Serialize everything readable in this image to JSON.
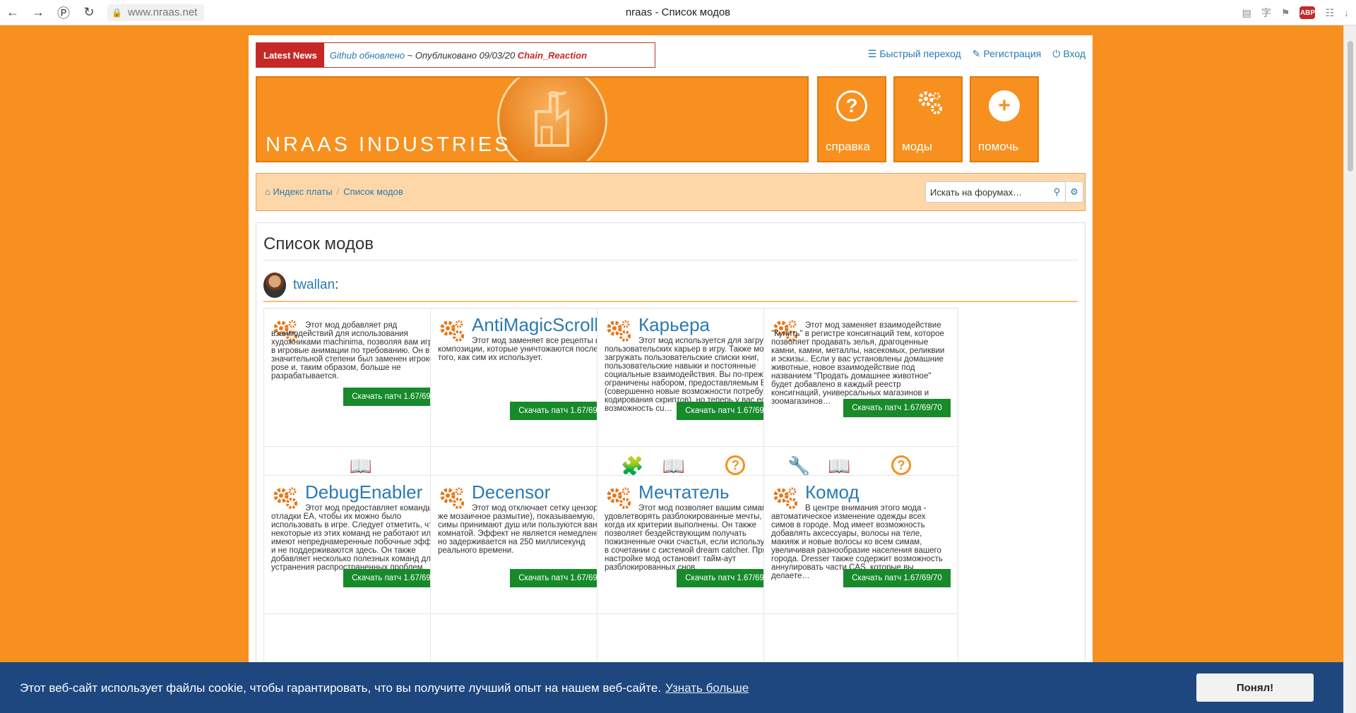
{
  "browser": {
    "url": "www.nraas.net",
    "tab_title": "nraas - Список модов"
  },
  "news": {
    "tag": "Latest News",
    "link": "Github обновлено",
    "middle": " ~ Опубликовано 09/03/20 ",
    "author": "Chain_Reaction"
  },
  "top_links": {
    "jump": "Быстрый переход",
    "register": "Регистрация",
    "login": "Вход"
  },
  "banner": {
    "title": "NRAAS INDUSTRIES"
  },
  "tiles": {
    "help": "справка",
    "mods": "моды",
    "assist": "помочь"
  },
  "breadcrumb": {
    "home": "Индекс платы",
    "current": "Список модов"
  },
  "search": {
    "placeholder": "Искать на форумах…"
  },
  "page": {
    "title": "Список модов"
  },
  "author": {
    "name": "twallan",
    "colon": ":"
  },
  "download_label": "Скачать патч 1.67/69/70",
  "cards": [
    {
      "title": "",
      "desc": "Этот мод добавляет ряд взаимодействий для использования художниками machinima, позволяя вам играть в игровые анимации по требованию. Он в значительной степени был заменен игроком pose и, таким образом, больше не разрабатывается.",
      "links": [
        "Документы"
      ]
    },
    {
      "title": "AntiMagicScroll",
      "desc": "Этот мод заменяет все рецепты и композиции, которые уничтожаются после того, как сим их использует.",
      "links": []
    },
    {
      "title": "Карьера",
      "desc": "Этот мод используется для загрузки пользовательских карьер в игру. Также можно загружать пользовательские списки книг, пользовательские навыки и постоянные социальные взаимодействия. Вы по-прежнему ограничены набором, предоставляемым EA (совершенно новые возможности потребуют кодирования скриптов), но теперь у вас есть возможность cu…",
      "links": [
        "Модули",
        "Документы",
        "Вопросы и ответы"
      ]
    },
    {
      "title": "",
      "desc": "Этот мод заменяет взаимодействие \"Купить\" в регистре консигнаций тем, которое позволяет продавать зелья, драгоценные камни, камни, металлы, насекомых, реликвии и эскизы.. Если у вас установлены домашние животные, новое взаимодействие под названием \"Продать домашнее животное\" будет добавлено в каждый реестр консигнаций, универсальных магазинов и зоомагазинов…",
      "links": [
        "Тюнинг",
        "Документы",
        "Вопросы и ответы"
      ]
    },
    {
      "title": "DebugEnabler",
      "desc": "Этот мод предоставляет команды отладки EA, чтобы их можно было использовать в игре. Следует отметить, что некоторые из этих команд не работают или имеют непреднамеренные побочные эффекты и не поддерживаются здесь. Он также добавляет несколько полезных команд для устранения распространенных проблем.",
      "links": []
    },
    {
      "title": "Decensor",
      "desc": "Этот мод отключает сетку цензора (он же мозаичное размытие), показываемую, когда симы принимают душ или пользуются ванной комнатой. Эффект не является немедленным, но задерживается на 250 миллисекунд реального времени.",
      "links": []
    },
    {
      "title": "Мечтатель",
      "desc": "Этот мод позволяет вашим симам удовлетворять разблокированные мечты, когда их критерии выполнены. Он также позволяет бездействующим получать пожизненные очки счастья, если используется в сочетании с системой dream catcher. При настройке мод остановит тайм-аут разблокированных снов.",
      "links": []
    },
    {
      "title": "Комод",
      "desc": "В центре внимания этого мода - автоматическое изменение одежды всех симов в городе. Мод имеет возможность добавлять аксессуары, волосы на теле, макияж и новые волосы ко всем симам, увеличивая разнообразие населения вашего города. Dresser также содержит возможность аннулировать части CAS, которые вы делаете…",
      "links": []
    }
  ],
  "cookie": {
    "message": "Этот веб-сайт использует файлы cookie, чтобы гарантировать, что вы получите лучший опыт на нашем веб-сайте.",
    "more": "Узнать больше",
    "accept": "Понял!"
  },
  "colors": {
    "page_bg": "#f7901e",
    "link": "#2a7ab0",
    "download_btn": "#178a2a",
    "cookie_bg": "#1e4780",
    "news_red": "#c62828"
  }
}
